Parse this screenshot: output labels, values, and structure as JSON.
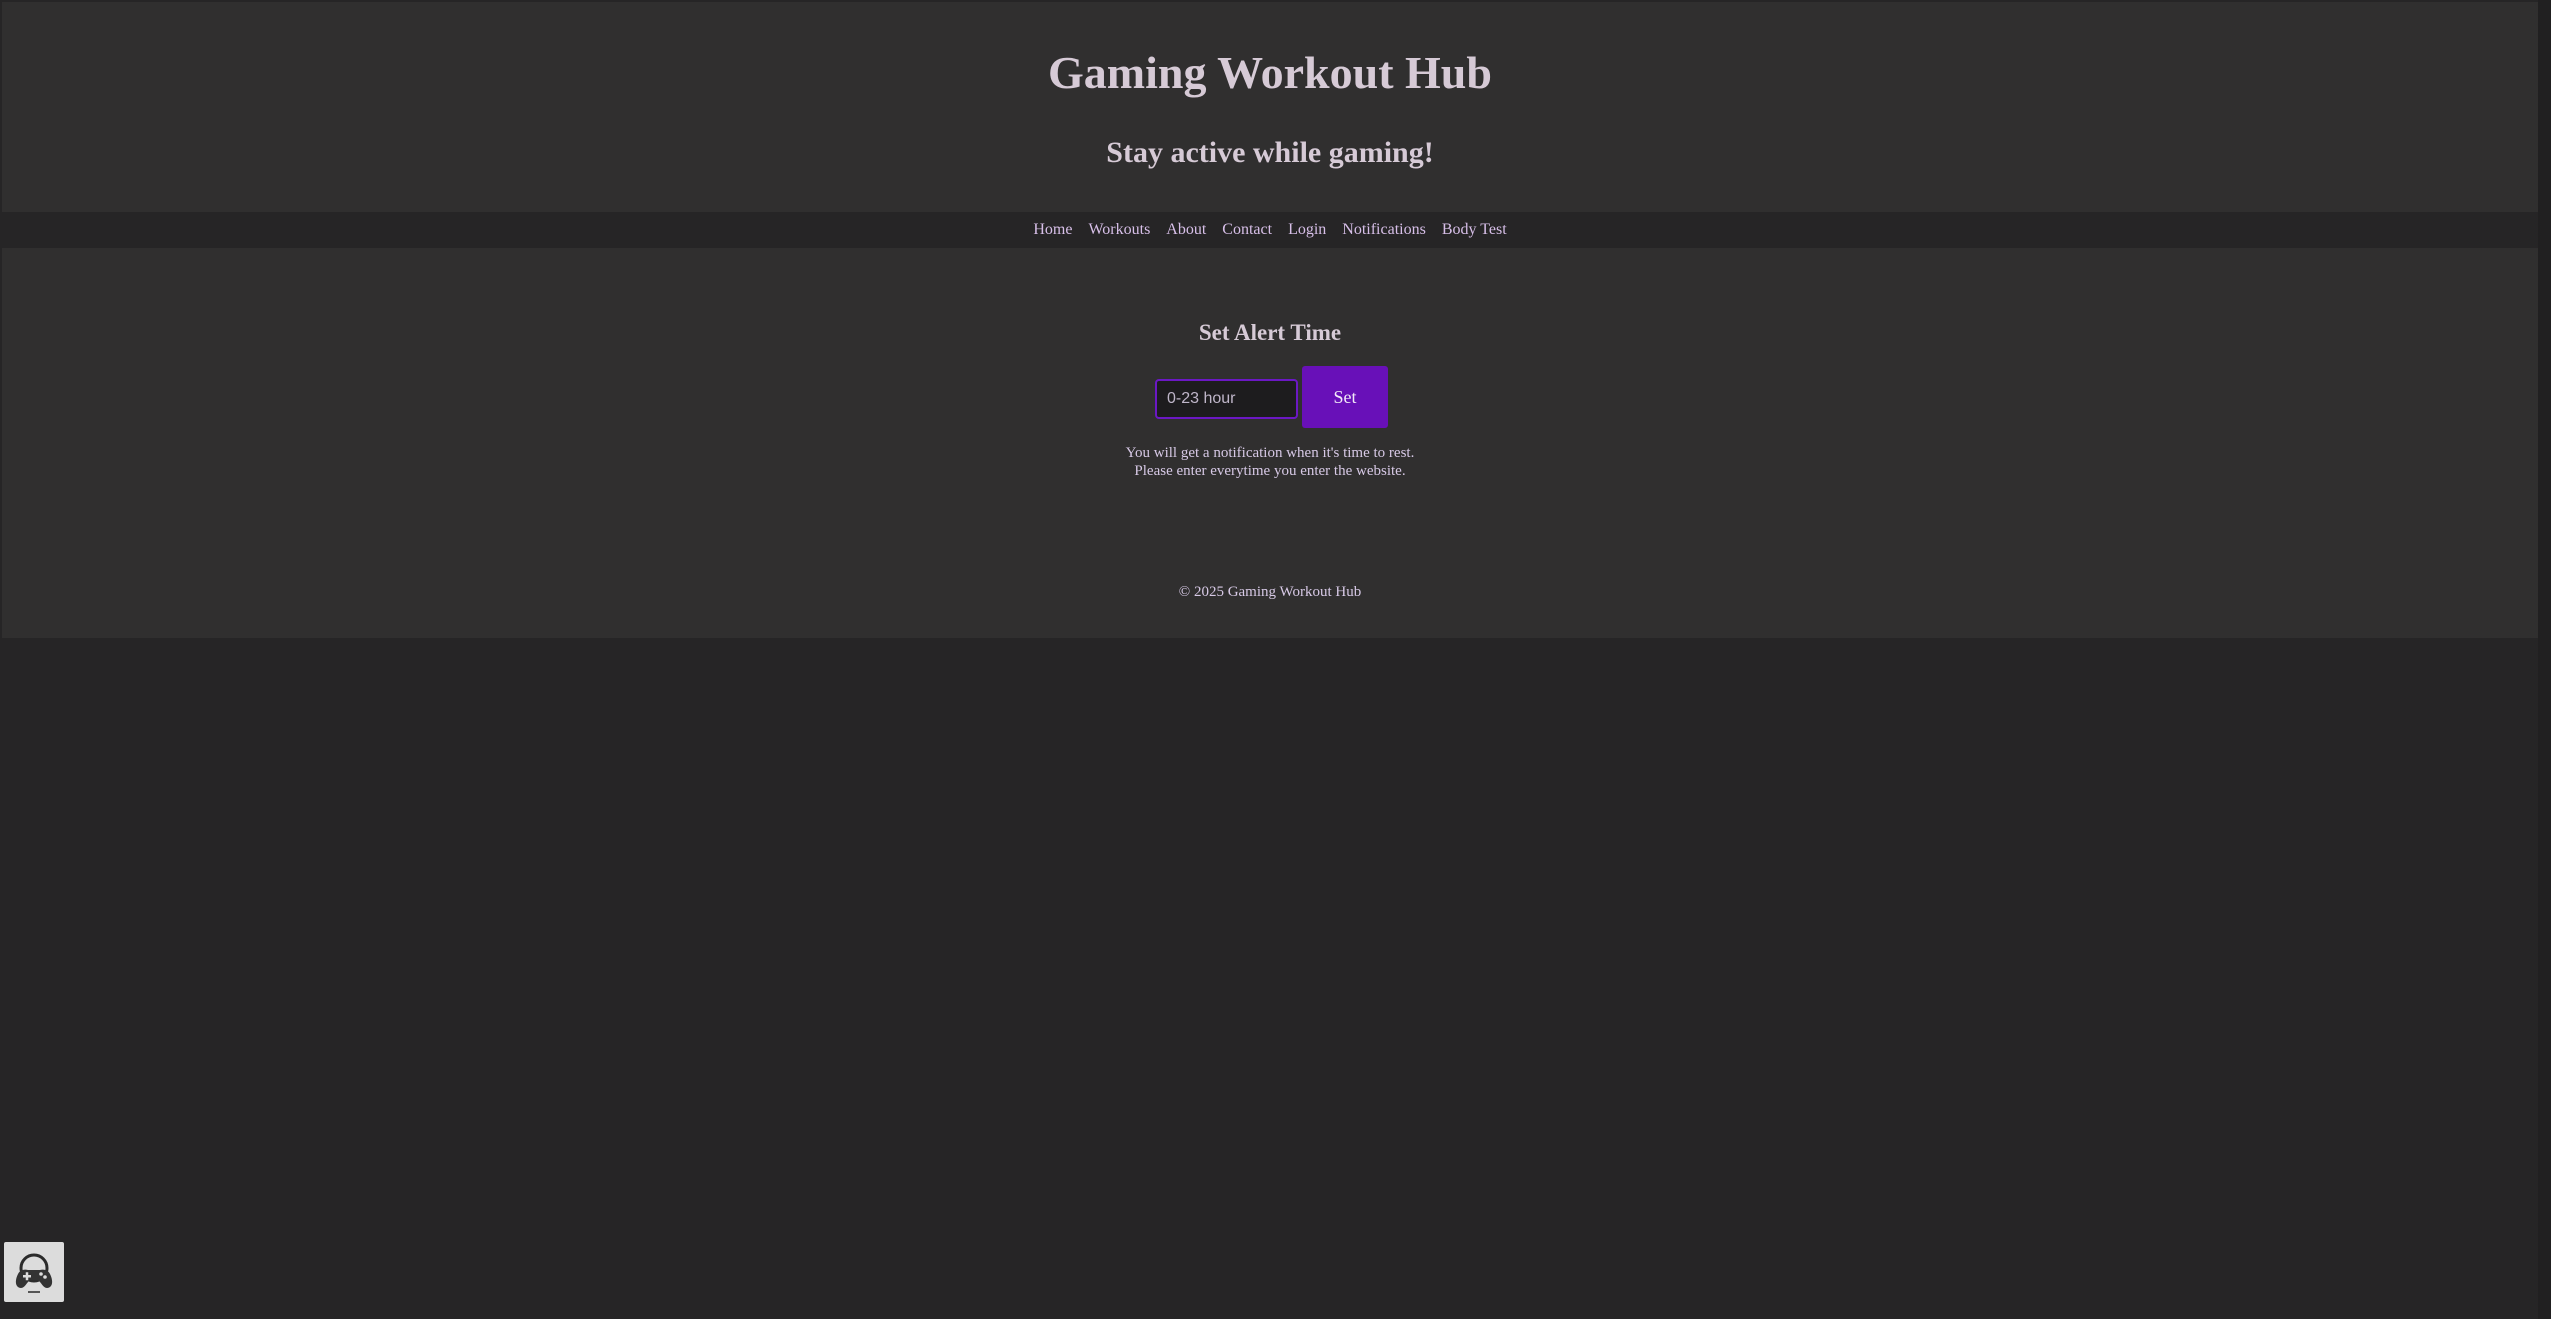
{
  "header": {
    "title": "Gaming Workout Hub",
    "tagline": "Stay active while gaming!"
  },
  "nav": {
    "items": [
      {
        "label": "Home"
      },
      {
        "label": "Workouts"
      },
      {
        "label": "About"
      },
      {
        "label": "Contact"
      },
      {
        "label": "Login"
      },
      {
        "label": "Notifications"
      },
      {
        "label": "Body Test"
      }
    ]
  },
  "alert": {
    "title": "Set Alert Time",
    "input_value": "",
    "input_placeholder": "0-23 hour",
    "button_label": "Set",
    "note_line1": "You will get a notification when it's time to rest.",
    "note_line2": "Please enter everytime you enter the website."
  },
  "footer": {
    "text": "© 2025 Gaming Workout Hub"
  },
  "widget": {
    "icon": "gamepad-icon"
  },
  "colors": {
    "accent": "#6810b8",
    "page_background": "#262526",
    "panel_background": "#302f2f",
    "text": "#d7c9e6"
  }
}
